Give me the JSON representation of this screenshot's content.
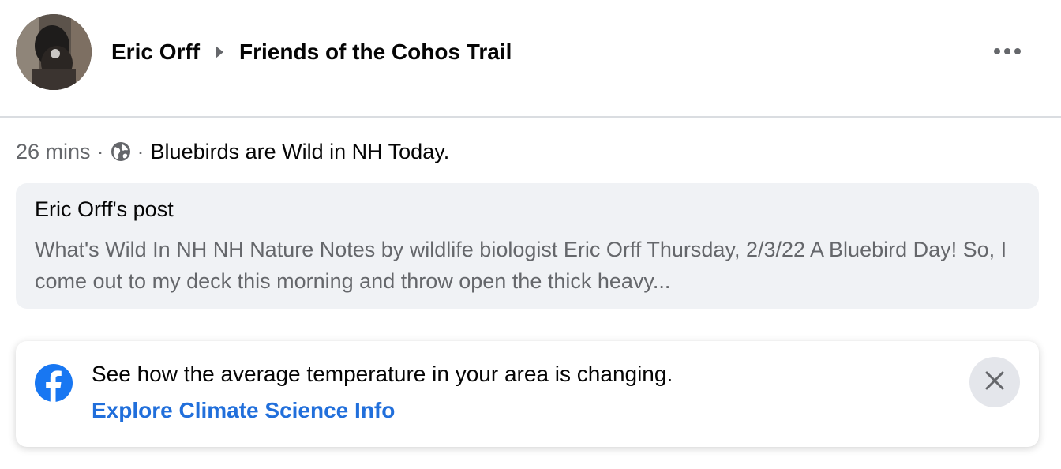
{
  "header": {
    "author": "Eric Orff",
    "group": "Friends of the Cohos Trail",
    "more_icon": "more-horizontal-icon"
  },
  "post_meta": {
    "time": "26 mins",
    "separator": "·",
    "privacy_icon": "globe-icon",
    "text": "Bluebirds are Wild in NH Today."
  },
  "shared_post": {
    "title": "Eric Orff's post",
    "excerpt": "What's Wild In NH NH Nature Notes by wildlife biologist Eric Orff Thursday, 2/3/22 A Bluebird Day! So, I come out to my deck this morning and throw open the thick heavy..."
  },
  "info_banner": {
    "icon": "facebook-logo-icon",
    "text": "See how the average temperature in your area is changing.",
    "link_label": "Explore Climate Science Info",
    "close_icon": "close-icon",
    "link_color": "#216fdb"
  }
}
